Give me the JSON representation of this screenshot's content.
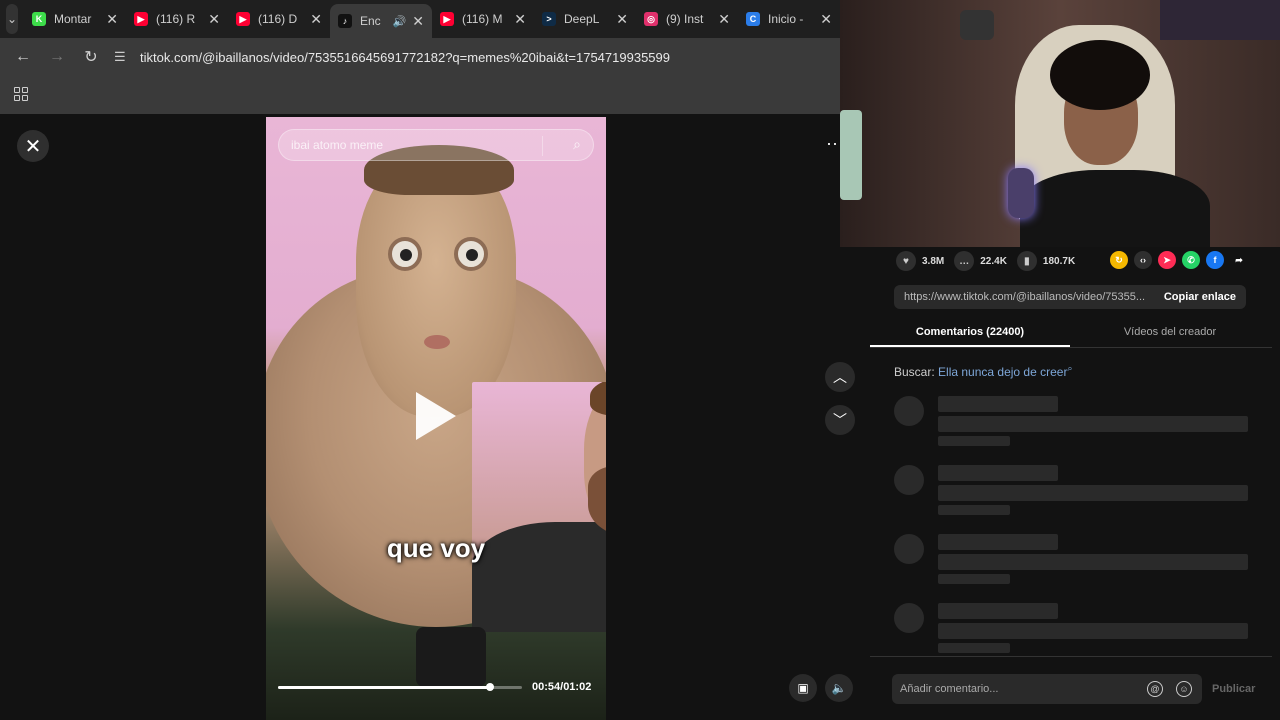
{
  "browser": {
    "tabs": [
      {
        "label": "Montar",
        "favicon": "K",
        "favicon_color": "#3ddc4a",
        "active": false
      },
      {
        "label": "(116) R",
        "favicon": "▶",
        "favicon_color": "#ff0033",
        "active": false
      },
      {
        "label": "(116) D",
        "favicon": "▶",
        "favicon_color": "#ff0033",
        "active": false
      },
      {
        "label": "Enc",
        "favicon": "♪",
        "favicon_color": "#111111",
        "active": true
      },
      {
        "label": "(116) M",
        "favicon": "▶",
        "favicon_color": "#ff0033",
        "active": false
      },
      {
        "label": "DeepL",
        "favicon": ">",
        "favicon_color": "#0f2b46",
        "active": false
      },
      {
        "label": "(9) Inst",
        "favicon": "◎",
        "favicon_color": "#e1306c",
        "active": false
      },
      {
        "label": "Inicio -",
        "favicon": "C",
        "favicon_color": "#2b7de9",
        "active": false
      }
    ],
    "url": "tiktok.com/@ibaillanos/video/7535516645691772182?q=memes%20ibai&t=1754719935599"
  },
  "video": {
    "search_placeholder": "ibai atomo meme",
    "caption": "que voy",
    "time": "00:54/01:02",
    "progress_fraction": 0.87
  },
  "panel": {
    "likes": "3.8M",
    "comments": "22.4K",
    "saves": "180.7K",
    "link": "https://www.tiktok.com/@ibaillanos/video/75355...",
    "copy_label": "Copiar enlace",
    "tab_comments": "Comentarios (22400)",
    "tab_creator": "Vídeos del creador",
    "search_prefix": "Buscar:",
    "search_query": "Ella nunca dejo de creer",
    "comment_placeholder": "Añadir comentario...",
    "publish_label": "Publicar"
  },
  "colors": {
    "accent_link": "#7ea7d8",
    "share_gold": "#f5b800",
    "share_red": "#fe2c55",
    "share_whatsapp": "#25d366",
    "share_facebook": "#1877f2"
  }
}
